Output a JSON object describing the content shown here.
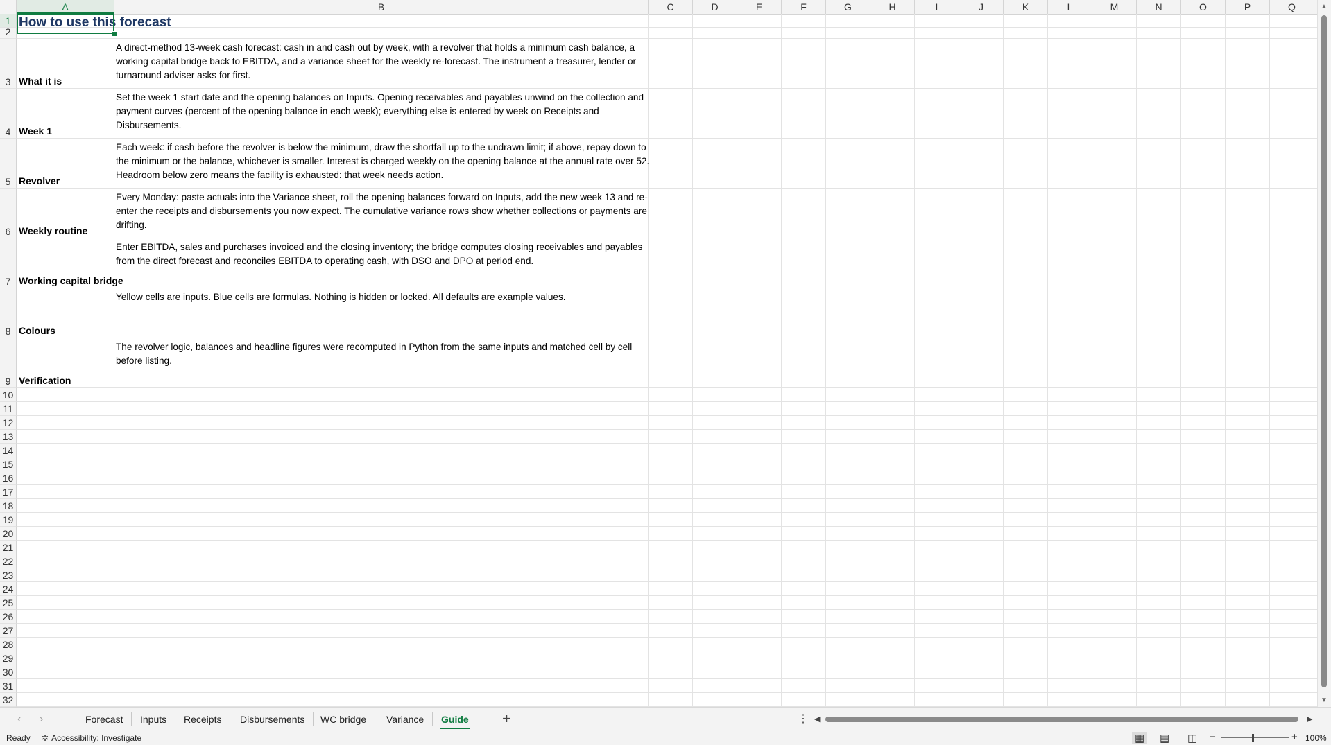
{
  "columns": [
    "A",
    "B",
    "C",
    "D",
    "E",
    "F",
    "G",
    "H",
    "I",
    "J",
    "K",
    "L",
    "M",
    "N",
    "O",
    "P",
    "Q"
  ],
  "selected_column": "A",
  "selected_row": "1",
  "title": "How to use this forecast",
  "rows": [
    {
      "num": "3",
      "label": "What it is",
      "text": "A direct-method 13-week cash forecast: cash in and cash out by week, with a revolver that holds a minimum cash balance, a working capital bridge back to EBITDA, and a variance sheet for the weekly re-forecast. The instrument a treasurer, lender or turnaround adviser asks for first."
    },
    {
      "num": "4",
      "label": "Week 1",
      "text": "Set the week 1 start date and the opening balances on Inputs. Opening receivables and payables unwind on the collection and payment curves (percent of the opening balance in each week); everything else is entered by week on Receipts and Disbursements."
    },
    {
      "num": "5",
      "label": "Revolver",
      "text": "Each week: if cash before the revolver is below the minimum, draw the shortfall up to the undrawn limit; if above, repay down to the minimum or the balance, whichever is smaller. Interest is charged weekly on the opening balance at the annual rate over 52. Headroom below zero means the facility is exhausted: that week needs action."
    },
    {
      "num": "6",
      "label": "Weekly routine",
      "text": "Every Monday: paste actuals into the Variance sheet, roll the opening balances forward on Inputs, add the new week 13 and re-enter the receipts and disbursements you now expect. The cumulative variance rows show whether collections or payments are drifting."
    },
    {
      "num": "7",
      "label": "Working capital bridge",
      "text": "Enter EBITDA, sales and purchases invoiced and the closing inventory; the bridge computes closing receivables and payables from the direct forecast and reconciles EBITDA to operating cash, with DSO and DPO at period end."
    },
    {
      "num": "8",
      "label": "Colours",
      "text": "Yellow cells are inputs. Blue cells are formulas. Nothing is hidden or locked. All defaults are example values."
    },
    {
      "num": "9",
      "label": "Verification",
      "text": "The revolver logic, balances and headline figures were recomputed in Python from the same inputs and matched cell by cell before listing."
    }
  ],
  "empty_rows": [
    "10",
    "11",
    "12",
    "13",
    "14",
    "15",
    "16",
    "17",
    "18",
    "19",
    "20",
    "21",
    "22",
    "23",
    "24",
    "25",
    "26",
    "27",
    "28",
    "29",
    "30",
    "31",
    "32"
  ],
  "row1_num": "1",
  "row2_num": "2",
  "sheet_tabs": [
    "Forecast",
    "Inputs",
    "Receipts",
    "Disbursements",
    "WC bridge",
    "Variance",
    "Guide"
  ],
  "active_tab": "Guide",
  "status": {
    "ready": "Ready",
    "accessibility": "Accessibility: Investigate",
    "zoom": "100%"
  },
  "icons": {
    "prev_sheet": "chevron-left-icon",
    "next_sheet": "chevron-right-icon",
    "add_sheet": "plus-icon",
    "more": "more-vertical-icon",
    "normal_view": "grid-view-icon",
    "page_layout": "page-layout-icon",
    "page_break": "page-break-icon"
  },
  "colors": {
    "accent": "#107c41",
    "title": "#1f3864"
  }
}
